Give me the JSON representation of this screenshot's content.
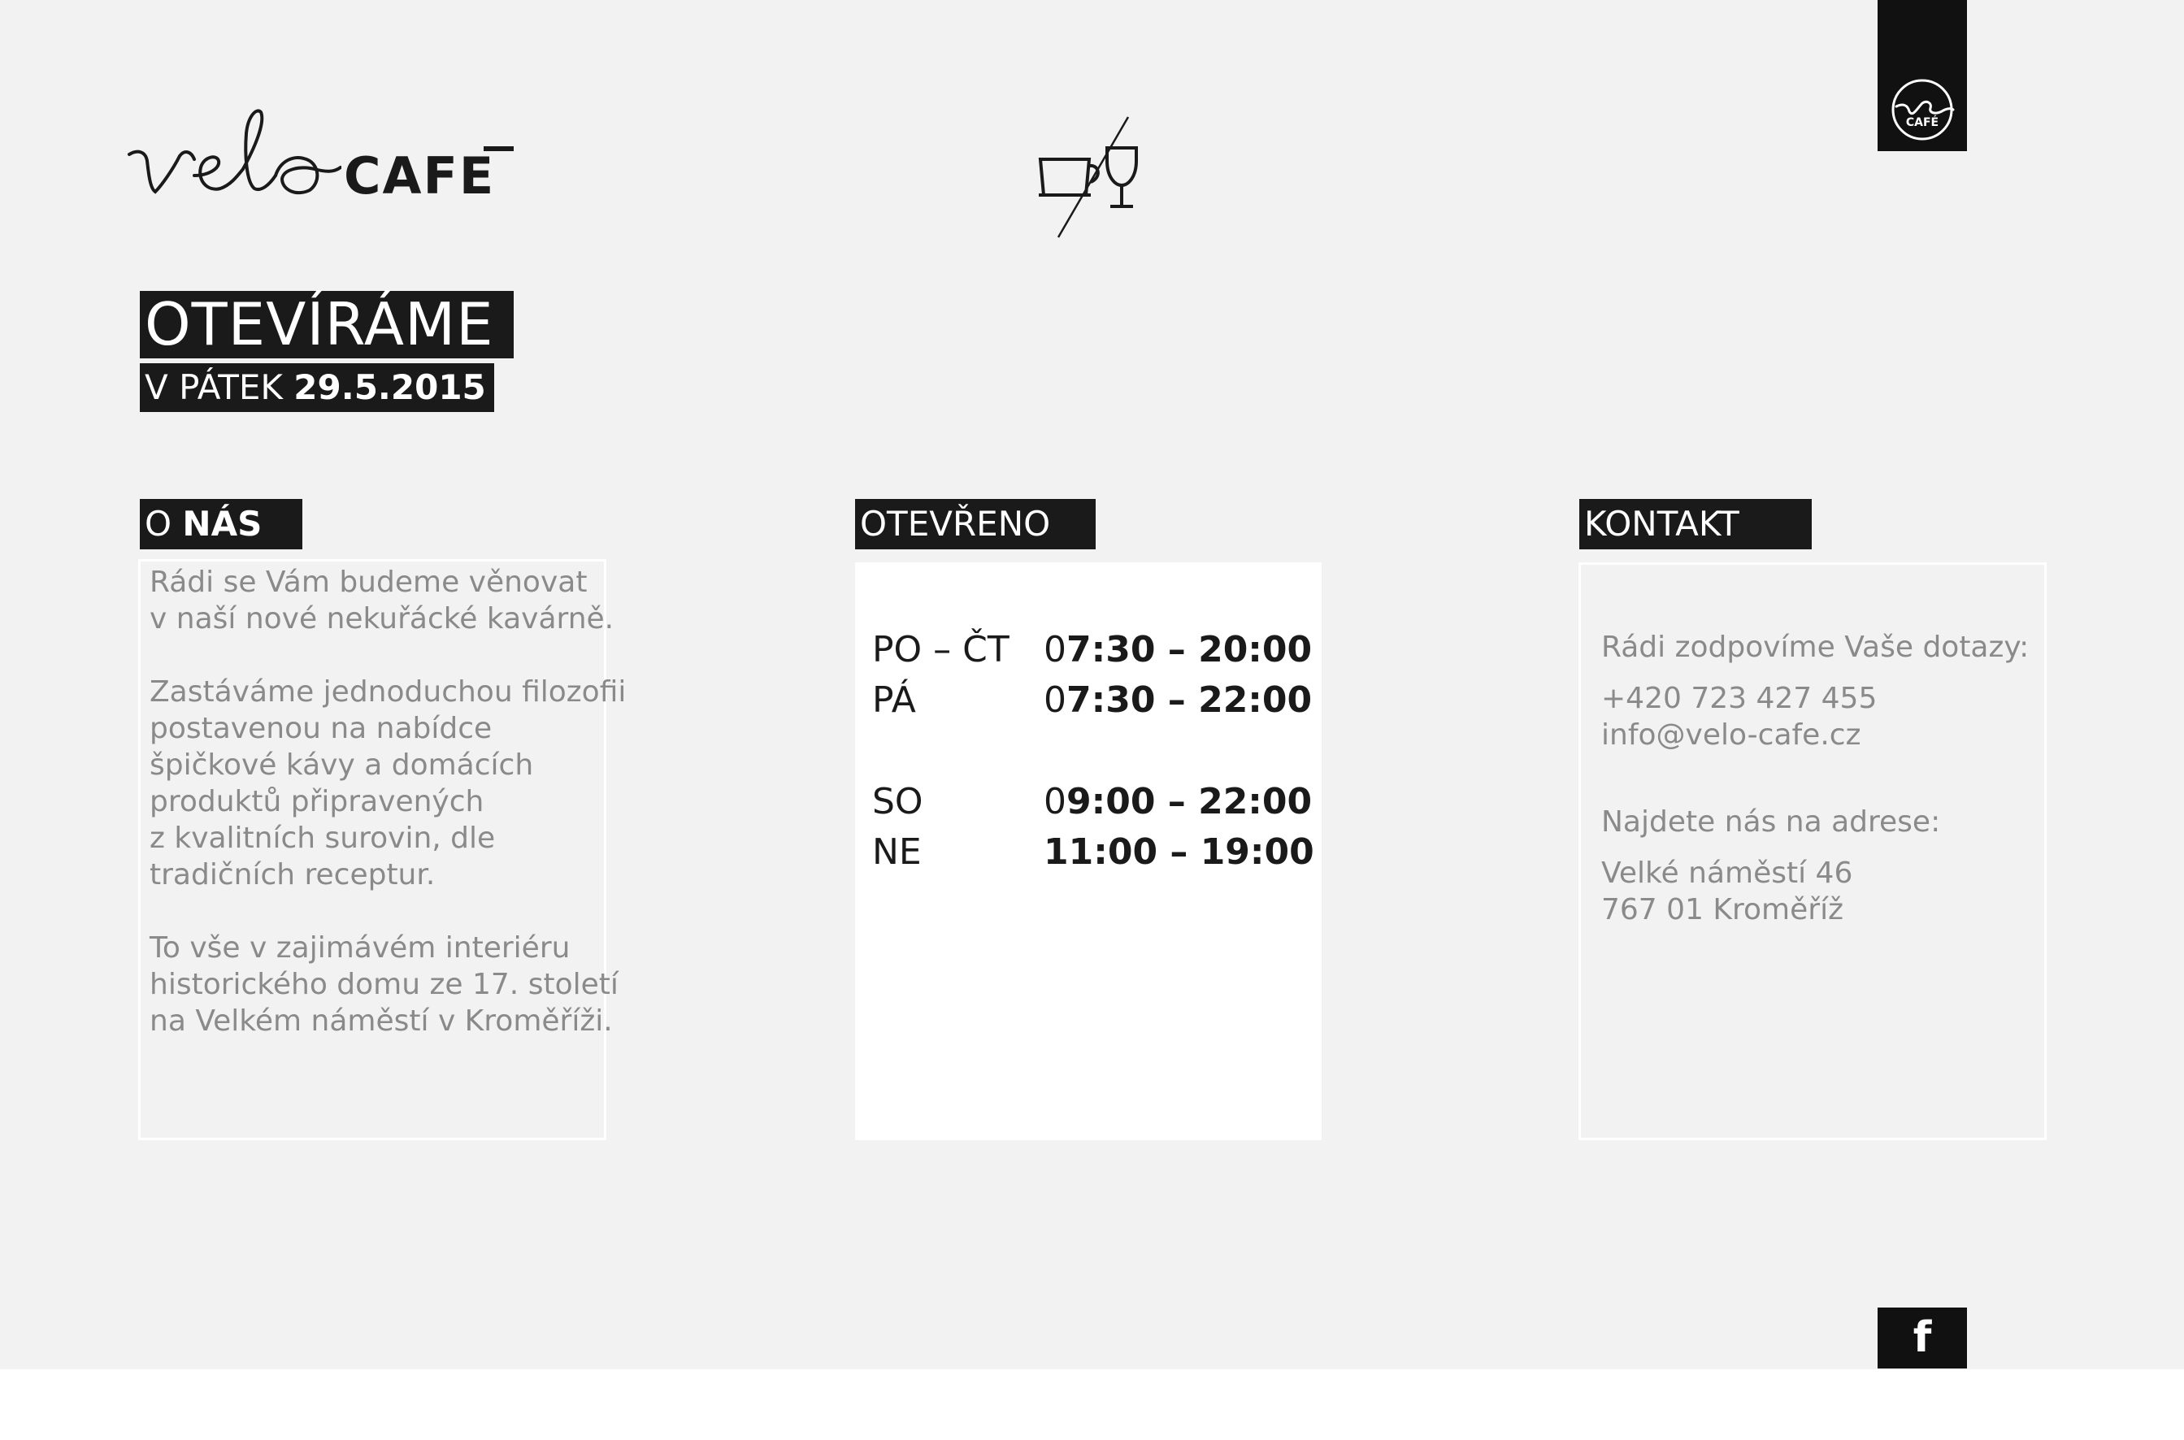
{
  "brand": {
    "script_text": "velo",
    "word": "CAFE",
    "badge_script": "velo",
    "badge_word": "CAFÉ",
    "icon": "cup-glass-icon"
  },
  "opening": {
    "title": "OTEVÍRÁME",
    "date_prefix": "V PÁTEK",
    "date": "29.5.2015"
  },
  "about": {
    "header_prefix": "O",
    "header_bold": "NÁS",
    "paragraphs": [
      [
        "Rádi se Vám budeme věnovat",
        "v naší nové nekuřácké kavárně."
      ],
      [
        "Zastáváme jednoduchou filozofii",
        "postavenou na nabídce",
        "špičkové kávy a domácích",
        "produktů připravených",
        "z kvalitních surovin, dle",
        "tradičních receptur."
      ],
      [
        "To vše v zajimávém interiéru",
        "historického domu ze 17. století",
        "na Velkém náměstí v Kroměříži."
      ]
    ]
  },
  "hours": {
    "header": "OTEVŘENO",
    "rows": [
      {
        "day": "PO – ČT",
        "time_lead": "0",
        "time_bold": "7:30 – 20:00"
      },
      {
        "day": "PÁ",
        "time_lead": "0",
        "time_bold": "7:30 – 22:00"
      },
      {
        "day": "SO",
        "time_lead": "0",
        "time_bold": "9:00 – 22:00"
      },
      {
        "day": "NE",
        "time_lead": "",
        "time_bold": "11:00 – 19:00"
      }
    ]
  },
  "contact": {
    "header": "KONTAKT",
    "intro": "Rádi zodpovíme Vaše dotazy:",
    "phone": "+420 723 427 455",
    "email": "info@velo-cafe.cz",
    "address_intro": "Najdete nás na adrese:",
    "address_line1": "Velké náměstí 46",
    "address_line2": "767 01 Kroměříž"
  },
  "social": {
    "facebook_label": "f",
    "icon": "facebook-icon"
  },
  "colors": {
    "background": "#f2f2f2",
    "dark": "#1a1a1a",
    "gray_text": "#8a8a8a",
    "white": "#ffffff"
  }
}
